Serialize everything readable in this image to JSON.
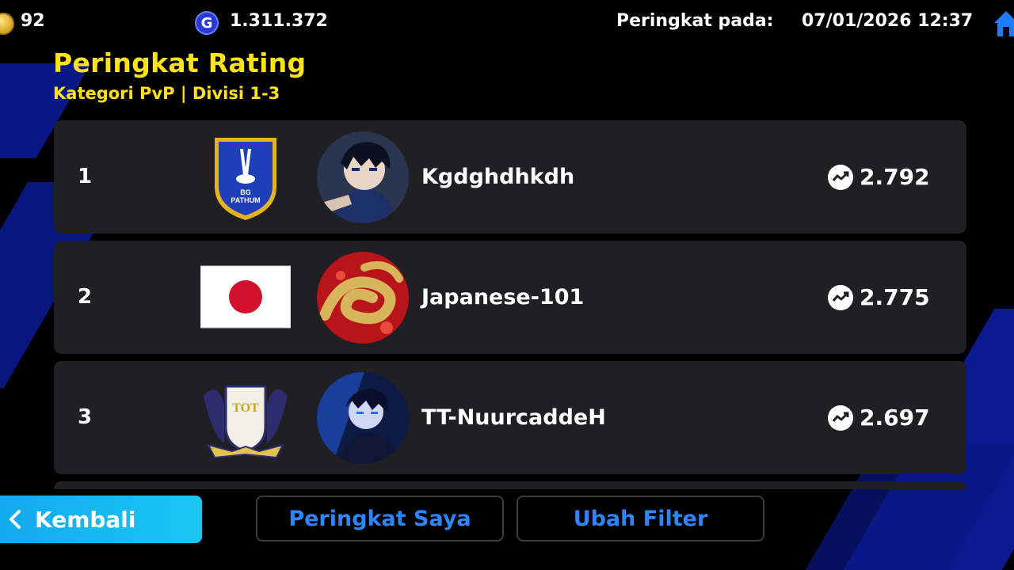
{
  "topbar": {
    "coins": "92",
    "gp_icon_letter": "G",
    "gp": "1.311.372",
    "rank_label": "Peringkat pada:",
    "rank_datetime": "07/01/2026 12:37"
  },
  "header": {
    "title": "Peringkat Rating",
    "subtitle": "Kategori PvP | Divisi 1-3"
  },
  "leaderboard": [
    {
      "rank": "1",
      "badge": "bg-pathum-crest",
      "badge_text": [
        "BG",
        "PATHUM"
      ],
      "name": "Kgdghdhkdh",
      "score": "2.792"
    },
    {
      "rank": "2",
      "badge": "japan-flag",
      "name": "Japanese-101",
      "score": "2.775"
    },
    {
      "rank": "3",
      "badge": "tot-crest",
      "badge_text": [
        "TOT"
      ],
      "name": "TT-NuurcaddeH",
      "score": "2.697"
    }
  ],
  "bottombar": {
    "back_label": "Kembali",
    "my_rank_label": "Peringkat Saya",
    "filter_label": "Ubah Filter"
  },
  "colors": {
    "title": "#ffe21a",
    "accent_blue": "#2d86ff",
    "back_button": "#13a8f0",
    "row_bg": "#1f1f24"
  }
}
